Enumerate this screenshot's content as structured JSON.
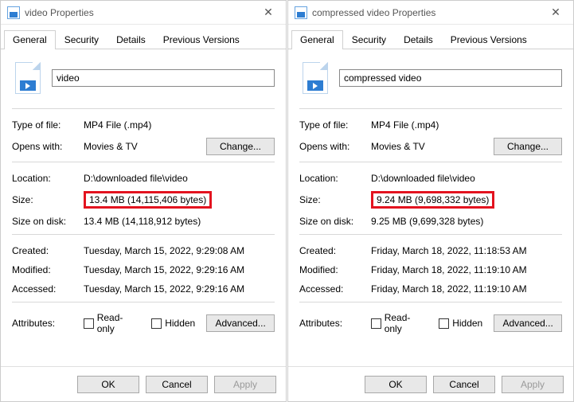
{
  "dialogs": [
    {
      "title": "video Properties",
      "filename": "video",
      "typeOfFile": "MP4 File (.mp4)",
      "opensWith": "Movies & TV",
      "location": "D:\\downloaded file\\video",
      "size": "13.4 MB (14,115,406 bytes)",
      "sizeOnDisk": "13.4 MB (14,118,912 bytes)",
      "created": "Tuesday, March 15, 2022, 9:29:08 AM",
      "modified": "Tuesday, March 15, 2022, 9:29:16 AM",
      "accessed": "Tuesday, March 15, 2022, 9:29:16 AM"
    },
    {
      "title": "compressed video Properties",
      "filename": "compressed video",
      "typeOfFile": "MP4 File (.mp4)",
      "opensWith": "Movies & TV",
      "location": "D:\\downloaded file\\video",
      "size": "9.24 MB (9,698,332 bytes)",
      "sizeOnDisk": "9.25 MB (9,699,328 bytes)",
      "created": "Friday, March 18, 2022, 11:18:53 AM",
      "modified": "Friday, March 18, 2022, 11:19:10 AM",
      "accessed": "Friday, March 18, 2022, 11:19:10 AM"
    }
  ],
  "tabs": {
    "general": "General",
    "security": "Security",
    "details": "Details",
    "previous": "Previous Versions"
  },
  "labels": {
    "typeOfFile": "Type of file:",
    "opensWith": "Opens with:",
    "change": "Change...",
    "location": "Location:",
    "size": "Size:",
    "sizeOnDisk": "Size on disk:",
    "created": "Created:",
    "modified": "Modified:",
    "accessed": "Accessed:",
    "attributes": "Attributes:",
    "readOnly": "Read-only",
    "hidden": "Hidden",
    "advanced": "Advanced...",
    "ok": "OK",
    "cancel": "Cancel",
    "apply": "Apply"
  }
}
